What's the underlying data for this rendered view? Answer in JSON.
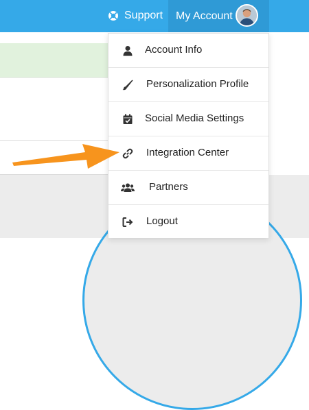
{
  "header": {
    "support_label": "Support",
    "support_icon": "lifebuoy-icon",
    "account_label": "My Account",
    "avatar_icon": "user-avatar"
  },
  "menu": {
    "items": [
      {
        "label": "Account Info",
        "icon": "user-icon"
      },
      {
        "label": "Personalization Profile",
        "icon": "paintbrush-icon"
      },
      {
        "label": "Social Media Settings",
        "icon": "calendar-check-icon"
      },
      {
        "label": "Integration Center",
        "icon": "link-icon"
      },
      {
        "label": "Partners",
        "icon": "users-icon"
      },
      {
        "label": "Logout",
        "icon": "sign-out-icon"
      }
    ]
  },
  "annotation": {
    "arrow_icon": "orange-arrow-icon",
    "arrow_color": "#f7941d"
  },
  "colors": {
    "header": "#35a9e8",
    "account_bg": "#2f9ad6",
    "highlight_green": "#e1f2dd"
  }
}
